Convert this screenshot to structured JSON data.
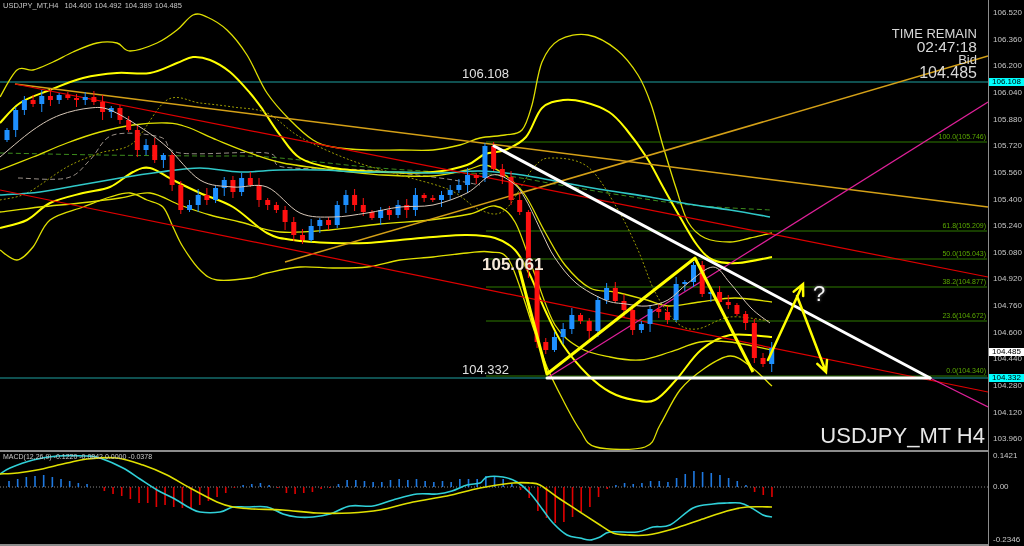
{
  "chart_header": {
    "symbol": "USDJPY_MT,H4",
    "ohlc": [
      "104.400",
      "104.492",
      "104.389",
      "104.485"
    ]
  },
  "info_panel": {
    "label": "TIME REMAIN",
    "time": "02:47:18",
    "bid_label": "Bid",
    "bid": "104.485"
  },
  "annotations": [
    {
      "text": "106.108",
      "kind": "plain"
    },
    {
      "text": "105.061",
      "kind": "bold"
    },
    {
      "text": "104.332",
      "kind": "plain"
    }
  ],
  "fibonacci": [
    {
      "label": "100.0(105.746)"
    },
    {
      "label": "61.8(105.209)"
    },
    {
      "label": "50.0(105.043)"
    },
    {
      "label": "38.2(104.877)"
    },
    {
      "label": "23.6(104.672)"
    },
    {
      "label": "0.0(104.340)"
    }
  ],
  "question_mark": "?",
  "symbol_label": "USDJPY_MT H4",
  "price_axis": {
    "ticks": [
      "106.520",
      "106.360",
      "106.200",
      "106.040",
      "105.880",
      "105.720",
      "105.560",
      "105.400",
      "105.240",
      "105.080",
      "104.920",
      "104.760",
      "104.600",
      "104.440",
      "104.280",
      "104.120",
      "103.960"
    ]
  },
  "price_tags": [
    {
      "text": "106.108",
      "kind": "level"
    },
    {
      "text": "104.485",
      "kind": "bid"
    },
    {
      "text": "104.332",
      "kind": "level"
    }
  ],
  "macd": {
    "header": "MACD(12,26,9) -0.1220 -0.0842 0.0000 -0.0378",
    "axis": [
      "0.1421",
      "0.00",
      "-0.2346"
    ]
  }
}
